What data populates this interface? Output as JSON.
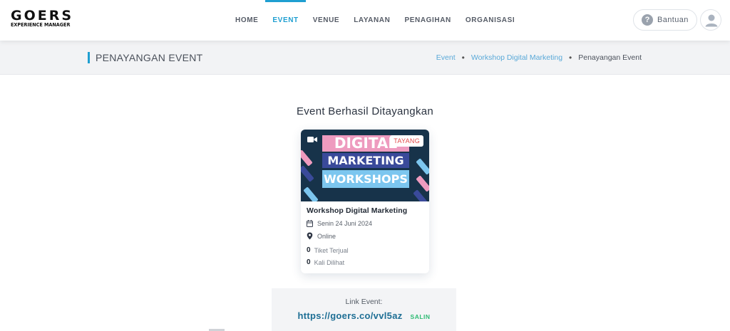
{
  "brand": {
    "name": "GOERS",
    "subtitle": "EXPERIENCE MANAGER"
  },
  "nav": [
    {
      "label": "HOME",
      "active": false
    },
    {
      "label": "EVENT",
      "active": true
    },
    {
      "label": "VENUE",
      "active": false
    },
    {
      "label": "LAYANAN",
      "active": false
    },
    {
      "label": "PENAGIHAN",
      "active": false
    },
    {
      "label": "ORGANISASI",
      "active": false
    }
  ],
  "help": {
    "label": "Bantuan",
    "icon": "question-circle-icon"
  },
  "user": {
    "icon": "user-icon"
  },
  "page": {
    "title": "PENAYANGAN EVENT",
    "breadcrumb": [
      "Event",
      "Workshop Digital Marketing",
      "Penayangan Event"
    ]
  },
  "main": {
    "heading": "Event Berhasil Ditayangkan",
    "card": {
      "banner_lines": [
        "DIGITAL",
        "MARKETING",
        "WORKSHOPS"
      ],
      "badge": "TAYANG",
      "title": "Workshop Digital Marketing",
      "date": "Senin 24 Juni 2024",
      "location": "Online",
      "tickets_sold": "0",
      "tickets_label": "Tiket Terjual",
      "views": "0",
      "views_label": "Kali Dilihat"
    },
    "link": {
      "label": "Link Event:",
      "url": "https://goers.co/vvl5az",
      "copy_label": "SALIN"
    }
  },
  "colors": {
    "accent": "#1f9fd1",
    "link": "#1d6e94",
    "copy": "#2dbb73",
    "badge": "#e24a4a"
  }
}
